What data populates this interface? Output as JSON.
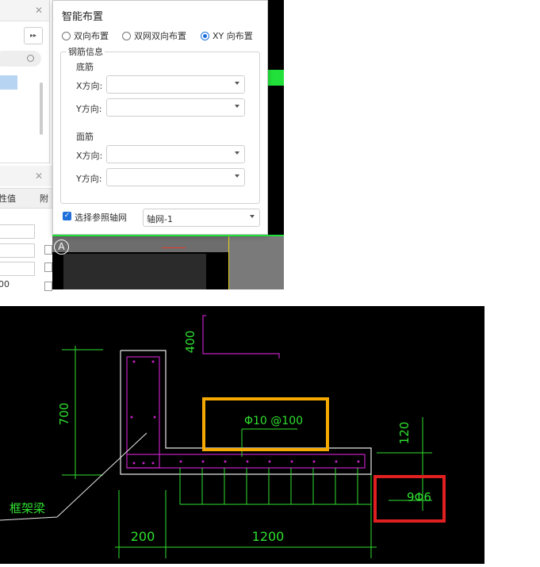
{
  "dialog": {
    "title": "智能布置",
    "radios": [
      {
        "label": "双向布置",
        "checked": false
      },
      {
        "label": "双网双向布置",
        "checked": false
      },
      {
        "label": "XY 向布置",
        "checked": true
      }
    ],
    "group_title": "钢筋信息",
    "bottom_section": "底筋",
    "top_section": "面筋",
    "x_label": "X方向:",
    "y_label": "Y方向:",
    "checkbox_label": "选择参照轴网",
    "grid_value": "轴网-1"
  },
  "left_panel": {
    "header_partial": "性值",
    "header_partial2": "附",
    "row_value": "00",
    "expand_glyph": "▸▸",
    "close_glyph": "✕"
  },
  "canvas": {
    "axis_marker": "A"
  },
  "drawing": {
    "dim_height": "700",
    "dim_400": "400",
    "dim_120": "120",
    "dim_200": "200",
    "dim_1200": "1200",
    "rebar_top": "Φ10 @100",
    "rebar_bottom": "9Φ6",
    "beam_label": "框架梁",
    "highlight_colors": {
      "box1": "#f5a800",
      "box2": "#e02020"
    }
  }
}
